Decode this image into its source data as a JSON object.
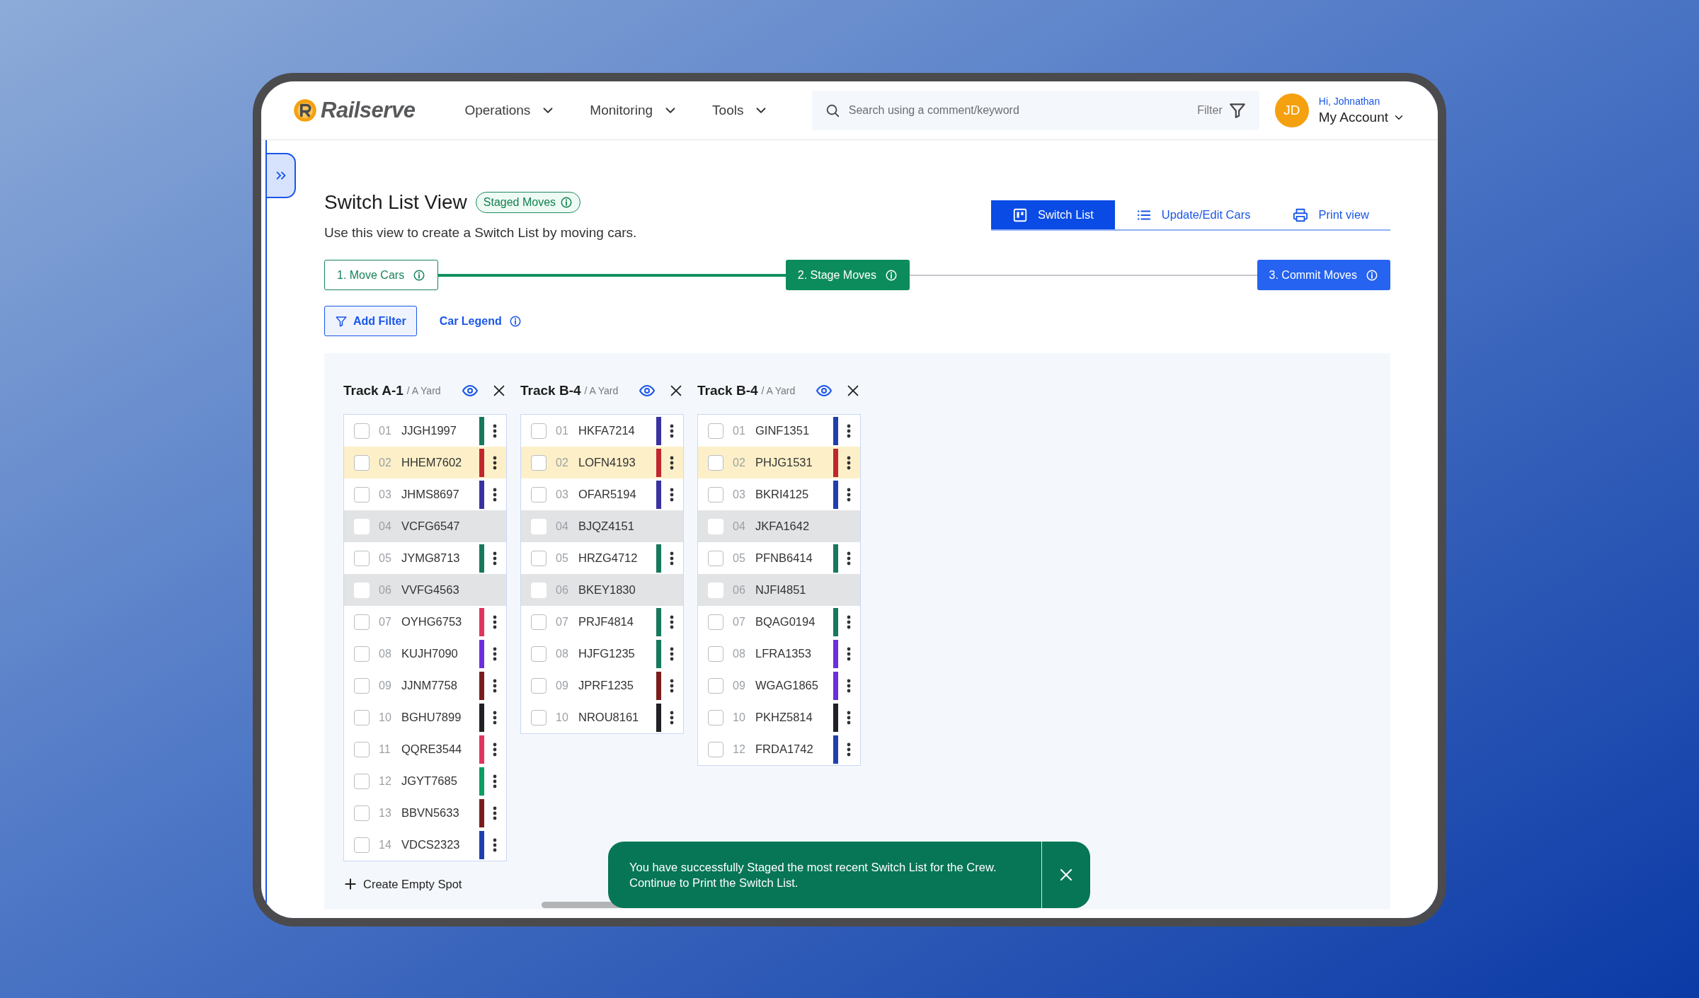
{
  "header": {
    "logo": "Railserve",
    "nav": [
      {
        "label": "Operations"
      },
      {
        "label": "Monitoring"
      },
      {
        "label": "Tools"
      }
    ],
    "search": {
      "placeholder": "Search using a comment/keyword",
      "filter_label": "Filter"
    },
    "account": {
      "initials": "JD",
      "greeting": "Hi, Johnathan",
      "label": "My Account"
    }
  },
  "page": {
    "title": "Switch List View",
    "badge": "Staged Moves",
    "subtitle": "Use this view to create a Switch List by moving cars."
  },
  "view_tabs": [
    {
      "label": "Switch List",
      "kind": "board",
      "selected": true
    },
    {
      "label": "Update/Edit Cars",
      "kind": "list",
      "selected": false
    },
    {
      "label": "Print view",
      "kind": "print",
      "selected": false
    }
  ],
  "steps": [
    {
      "label": "1. Move Cars",
      "completed": true,
      "current": false
    },
    {
      "label": "2. Stage Moves",
      "completed": false,
      "current": true
    },
    {
      "label": "3. Commit Moves",
      "completed": false,
      "current": false
    }
  ],
  "actions": {
    "filter_button": "Add Filter",
    "legend_link": "Car Legend"
  },
  "tracks": [
    {
      "name": "Track A-1",
      "yard": "/ A Yard",
      "rows": [
        {
          "kind": "car",
          "number": "01",
          "car": "JJGH1997",
          "color": "#17785c",
          "highlighted": false
        },
        {
          "kind": "car",
          "number": "02",
          "car": "HHEM7602",
          "color": "#c0262d",
          "highlighted": true
        },
        {
          "kind": "car",
          "number": "03",
          "car": "JHMS8697",
          "color": "#3a32a0",
          "highlighted": false
        },
        {
          "kind": "empty",
          "number": "04",
          "car": "VCFG6547"
        },
        {
          "kind": "car",
          "number": "05",
          "car": "JYMG8713",
          "color": "#17785c",
          "highlighted": false
        },
        {
          "kind": "empty",
          "number": "06",
          "car": "VVFG4563"
        },
        {
          "kind": "car",
          "number": "07",
          "car": "OYHG6753",
          "color": "#e0335e",
          "highlighted": false
        },
        {
          "kind": "car",
          "number": "08",
          "car": "KUJH7090",
          "color": "#6d2ee0",
          "highlighted": false
        },
        {
          "kind": "car",
          "number": "09",
          "car": "JJNM7758",
          "color": "#7b1d1d",
          "highlighted": false
        },
        {
          "kind": "car",
          "number": "10",
          "car": "BGHU7899",
          "color": "#202124",
          "highlighted": false
        },
        {
          "kind": "car",
          "number": "11",
          "car": "QQRE3544",
          "color": "#e0335e",
          "highlighted": false
        },
        {
          "kind": "car",
          "number": "12",
          "car": "JGYT7685",
          "color": "#0c9d62",
          "highlighted": false
        },
        {
          "kind": "car",
          "number": "13",
          "car": "BBVN5633",
          "color": "#7b1d1d",
          "highlighted": false
        },
        {
          "kind": "car",
          "number": "14",
          "car": "VDCS2323",
          "color": "#1f3fae",
          "highlighted": false
        }
      ]
    },
    {
      "name": "Track B-4",
      "yard": "/ A Yard",
      "rows": [
        {
          "kind": "car",
          "number": "01",
          "car": "HKFA7214",
          "color": "#3a32a0",
          "highlighted": false
        },
        {
          "kind": "car",
          "number": "02",
          "car": "LOFN4193",
          "color": "#c0262d",
          "highlighted": true
        },
        {
          "kind": "car",
          "number": "03",
          "car": "OFAR5194",
          "color": "#3a32a0",
          "highlighted": false
        },
        {
          "kind": "empty",
          "number": "04",
          "car": "BJQZ4151"
        },
        {
          "kind": "car",
          "number": "05",
          "car": "HRZG4712",
          "color": "#17785c",
          "highlighted": false
        },
        {
          "kind": "empty",
          "number": "06",
          "car": "BKEY1830"
        },
        {
          "kind": "car",
          "number": "07",
          "car": "PRJF4814",
          "color": "#17785c",
          "highlighted": false
        },
        {
          "kind": "car",
          "number": "08",
          "car": "HJFG1235",
          "color": "#17785c",
          "highlighted": false
        },
        {
          "kind": "car",
          "number": "09",
          "car": "JPRF1235",
          "color": "#7b1d1d",
          "highlighted": false
        },
        {
          "kind": "car",
          "number": "10",
          "car": "NROU8161",
          "color": "#202124",
          "highlighted": false
        }
      ]
    },
    {
      "name": "Track B-4",
      "yard": "/ A Yard",
      "rows": [
        {
          "kind": "car",
          "number": "01",
          "car": "GINF1351",
          "color": "#1f3fae",
          "highlighted": false
        },
        {
          "kind": "car",
          "number": "02",
          "car": "PHJG1531",
          "color": "#c0262d",
          "highlighted": true
        },
        {
          "kind": "car",
          "number": "03",
          "car": "BKRI4125",
          "color": "#1f3fae",
          "highlighted": false
        },
        {
          "kind": "empty",
          "number": "04",
          "car": "JKFA1642"
        },
        {
          "kind": "car",
          "number": "05",
          "car": "PFNB6414",
          "color": "#17785c",
          "highlighted": false
        },
        {
          "kind": "empty",
          "number": "06",
          "car": "NJFI4851"
        },
        {
          "kind": "car",
          "number": "07",
          "car": "BQAG0194",
          "color": "#17785c",
          "highlighted": false
        },
        {
          "kind": "car",
          "number": "08",
          "car": "LFRA1353",
          "color": "#6d2ee0",
          "highlighted": false
        },
        {
          "kind": "car",
          "number": "09",
          "car": "WGAG1865",
          "color": "#6d2ee0",
          "highlighted": false
        },
        {
          "kind": "car",
          "number": "10",
          "car": "PKHZ5814",
          "color": "#202124",
          "highlighted": false
        },
        {
          "kind": "car",
          "number": "12",
          "car": "FRDA1742",
          "color": "#1f3fae",
          "highlighted": false
        }
      ]
    }
  ],
  "create_spot": "Create Empty Spot",
  "toast": {
    "message": "You have successfully Staged the most recent Switch List for the Crew.\nContinue to Print the Switch List."
  }
}
